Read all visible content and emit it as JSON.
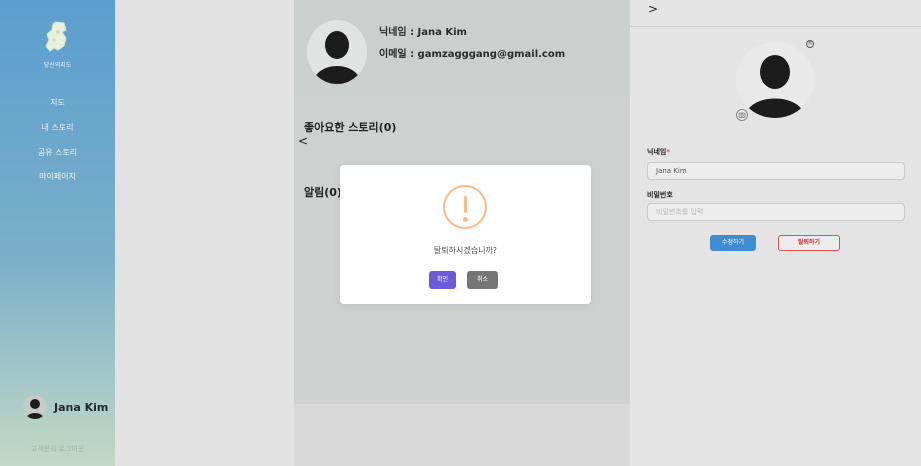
{
  "sidebar": {
    "logo_text": "당신의지도",
    "items": [
      {
        "label": "지도"
      },
      {
        "label": "내 스토리"
      },
      {
        "label": "공유 스토리"
      },
      {
        "label": "마이페이지"
      }
    ],
    "user_name": "Jana Kim",
    "logout": "고객문의 로그아웃"
  },
  "profile": {
    "nickname_line": "닉네임 : Jana Kim",
    "email_line": "이메일 : gamzagggang@gmail.com"
  },
  "sections": {
    "liked_stories": "좋아요한 스토리(0)",
    "alerts": "알림(0)",
    "left_chevron": "<"
  },
  "edit_panel": {
    "back_chevron": ">",
    "registered_mark": "®",
    "nickname_label": "닉네임",
    "required_mark": "*",
    "nickname_value": "Jana Kim",
    "password_label": "비밀번호",
    "password_placeholder": "비밀번호를 입력",
    "update_button": "수정하기",
    "withdraw_button": "탈퇴하기"
  },
  "modal": {
    "icon": "warning-icon",
    "icon_symbol": "!",
    "message": "탈퇴하시겠습니까?",
    "confirm": "확인",
    "cancel": "취소"
  },
  "colors": {
    "sidebar_top": "#5c9ecf",
    "sidebar_bottom": "#c3d8c6",
    "confirm_button": "#6a5bd6",
    "cancel_button": "#757575",
    "update_button": "#3e8dd1",
    "withdraw_border": "#d9534f",
    "warning": "#f8bb86"
  }
}
